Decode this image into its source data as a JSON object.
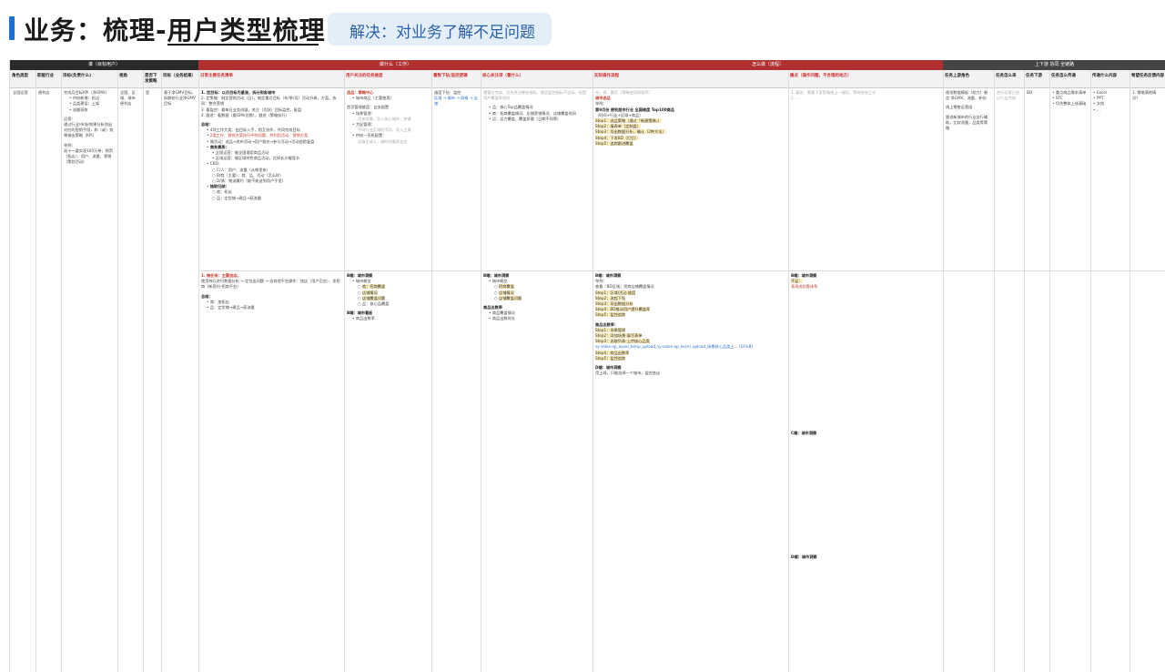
{
  "header": {
    "title": "业务：梳理-用户类型梳理",
    "subtitle": "解决：对业务了解不足问题"
  },
  "table": {
    "groups": [
      {
        "label": "谁（目标用户）"
      },
      {
        "label": "做什么（工作）"
      },
      {
        "label": "怎么做（流程）"
      },
      {
        "label": "上下游 协同 全链路"
      }
    ],
    "columns": [
      {
        "label": "角色类型"
      },
      {
        "label": "职能行业"
      },
      {
        "label": "目标(负责什么)"
      },
      {
        "label": "视角"
      },
      {
        "label": "是否下发策略"
      },
      {
        "label": "目标（业务结果）"
      },
      {
        "label": "日常主要任务清单"
      },
      {
        "label": "用户关注的任务维度"
      },
      {
        "label": "看数下钻/监控逻辑"
      },
      {
        "label": "核心关注项（看什么）"
      },
      {
        "label": "实际操作流程"
      },
      {
        "label": "痛点（操作问题，不合理的地方）"
      },
      {
        "label": "任务上游角色"
      },
      {
        "label": "任务怎么来"
      },
      {
        "label": "任务下游"
      },
      {
        "label": "任务怎么传递"
      },
      {
        "label": "传递什么内容"
      },
      {
        "label": "希望任务反馈内容"
      }
    ],
    "row1": {
      "role": "全国运营",
      "industry": "便利店",
      "goal": {
        "title": "完成月目标KPI（净GMV）",
        "items": [
          "供给新增：拓店",
          "品类建设：上架",
          "流量获取"
        ],
        "ops_label": "运营：",
        "ops_text": "通过行业/市场/效果分析找出对应的营销手段，和（或）效果做出策略（KPI）",
        "example_label": "举例：",
        "example_text": "双十一要实现100万单，预判（拓店）、用户、流量、营销（策划活动）"
      },
      "view": "全国、区域、城市 便利店",
      "issue": "是",
      "biz_goal": "基于净GMV目标，拆解各行业净GMV目标",
      "tasks": {
        "t1": "1. 定目标：以月目标为基准，拆分到各城市",
        "t2": "2. 定策略：制定营销活动（日），制定重点目标（年/季/月）活动节奏，方案。协同：整合营销",
        "t3": "3. 看监控：看每日业务进展，关注（活跃）目标监控，复盘",
        "t4": "4. 跟进：看数据（看GMV总数），跟进（策略执行）",
        "summary_label": "总结：",
        "s1": "4项工作大类：由目标入手，相互协作，共同完成目标",
        "s2": "2类工作：营销方案执行中的问题，并利用活动、营销方案",
        "s3": "做活动：选品→发布活动→用户报名→参与活动→活动追踪复盘",
        "s4": "商务素质：",
        "s5": "全国运营：做全国通用商品活动",
        "s6": "区域运营：做区域特色商品活动，比如长沙榴莲节",
        "s7": "CBD：",
        "s8": "C/人：用户、流量（从哪里来）",
        "s9": "B/商（主要）：商、品、活动（怎么样）",
        "s10": "D/骑：物流履约（能不能送到用户手里）",
        "s11": "抽取归纳：",
        "s12": "商：拓店",
        "s13": "品：定货铺→建品→获流量"
      },
      "dimensions": {
        "title": "选品：策略中心",
        "items": [
          "城市商品（主要使用）"
        ],
        "extra_title": "首页管理维度：业务配置",
        "e1": "场景管理：",
        "e2": "添加场景，导入核心城市，关键",
        "e3": "大促管理：",
        "e4": "不同行业区域的不同，导入工具",
        "e5": "供给一页纸配置：",
        "e6": "初级生成人，做时间看其业务"
      },
      "monitor": {
        "title": "维度下钻：监控",
        "path1": "区域 → 城市 → 网格 → 店铺"
      },
      "focus": {
        "intro": "需要在完成、优先关注哪些指标，就会监控指标不达标、但是用户覆盖率如何",
        "items": [
          "品：核心Top品覆盖情况",
          "商：拓商覆盖情况、店铺营销情况、店铺覆盖时间",
          "运：运力覆盖、覆盖质量（日期不同等）"
        ]
      },
      "flow": {
        "intro": "先、再、最后（策略使用的顺序）",
        "city_label": "城市选品",
        "example": "举例：",
        "e1": "第9月份 便利超市行业 全国维度 Top100商品",
        "e2": "（时间+行业+区域+商品）",
        "step1": "Step1：选品策略（通过『新建策略』）",
        "step2": "Step2：填表单（定制类）",
        "step3": "Step3：导出数据分析，确认（2种方法）",
        "step4": "Step4：下发BD（打钉）",
        "step5": "Step5：追踪跟进覆盖"
      },
      "pain": {
        "p1": "1. 痛苦：需要下发策略线上一键化，等待答复工作",
        "p2": "2. ..."
      },
      "upstream": {
        "u1": "视觉数据模板（助力）制定 净GMV、流量、补贴",
        "u2": "线上零售运营组",
        "u3": "跟进新城市的行业自行辅助，比较流量，品类等策略"
      },
      "howcome": "首行运营已经以行业完成",
      "downstream": "BD",
      "transfer": [
        "重点商品需求清单",
        "STC",
        "切合整体上线基础"
      ],
      "content": [
        "Excel",
        "PPT",
        "文档",
        "..."
      ],
      "feedback": [
        "策略落地情况？"
      ]
    },
    "row2": {
      "tasks_a": "1. 做任务：主要加店。",
      "tasks_b": "使用神兵进行数据分析 → 定位出问题 → 去其他平台操作：加店（用户后台），发招商（新签约-招商平台）",
      "summary": "总结：",
      "sa": "商：加拓店",
      "sb": "品：定货铺→建品→获流量",
      "dim_title": "B端：城市洞察",
      "dim_items": [
        "城市概览",
        "商：招商覆盖",
        "店铺情况",
        "店铺覆盖问题",
        "品：核心品覆盖"
      ],
      "dim2_title": "B端：城市看板",
      "dim2_item": "商品出数率",
      "mon_title": "B端：城市洞察",
      "mon_items": [
        "城市概览",
        "招商覆盖",
        "店铺情况",
        "店铺覆盖问题"
      ],
      "mon2_title": "商品出数率",
      "mon2_items": [
        "商品覆盖情况",
        "商品出数时长"
      ],
      "flow_title": "B端：城市洞察",
      "flow_ex": "举例：",
      "flow_s1": "查看『BD区域』招商店铺覆盖情况",
      "flow_s2": "Step1：区域/活动 维度",
      "flow_s3": "Step2：流程下钻",
      "flow_s4": "Step3：导出数据分析",
      "flow_s5": "Step4：BD推动用户提升覆盖率",
      "flow_s6": "Step5：监控追踪",
      "flow_b1": "商品出数率：",
      "flow_b2": "Step1：场景管理",
      "flow_b3": "Step2：添加场景-填写表单",
      "flow_b4": "Step3：选取列表-上传核心品类",
      "flow_link": "sy-sales-op_excel_temp_upload_sy-sales-op_excel_upload_场景核心品类上... (10 kB)",
      "flow_b5": "Step4：商品出数率",
      "flow_b6": "Step5：监控追踪",
      "flow_c": "D端：城市洞察",
      "flow_c2": "用上线，只能选择一个城市，监控各店",
      "pain_title": "B端：城市洞察",
      "pain_sub": "不足：",
      "pain_red": "表现成拉客体系",
      "pain_c": "C端：城市洞察",
      "pain_d": "D端：城市洞察"
    }
  }
}
